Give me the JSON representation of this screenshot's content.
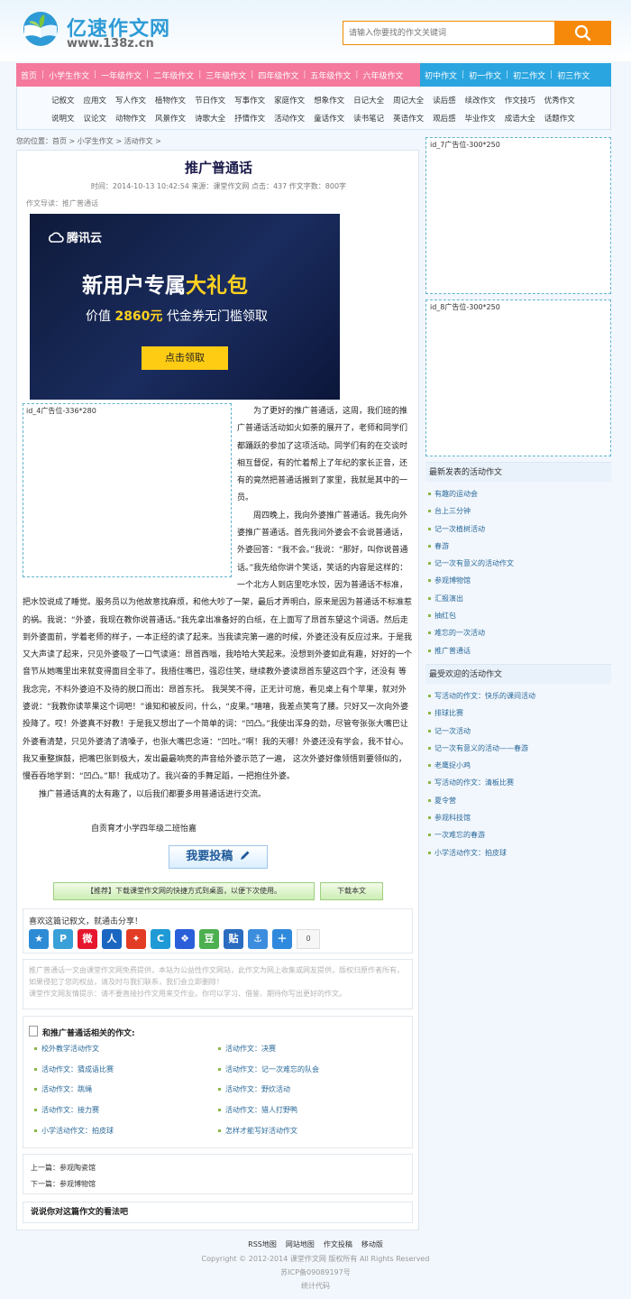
{
  "site": {
    "name": "亿速作文网",
    "url": "www.138z.cn"
  },
  "search": {
    "placeholder": "请输入你要找的作文关键词"
  },
  "nav": {
    "pink": [
      "首页",
      "小学生作文",
      "一年级作文",
      "二年级作文",
      "三年级作文",
      "四年级作文",
      "五年级作文",
      "六年级作文"
    ],
    "blue": [
      "初中作文",
      "初一作文",
      "初二作文",
      "初三作文"
    ]
  },
  "subnav": {
    "row1": [
      "记叙文",
      "应用文",
      "写人作文",
      "植物作文",
      "节日作文",
      "写事作文",
      "家庭作文",
      "想象作文",
      "日记大全",
      "周记大全",
      "读后感",
      "续改作文",
      "作文技巧",
      "优秀作文"
    ],
    "row2": [
      "说明文",
      "议论文",
      "动物作文",
      "风景作文",
      "诗歌大全",
      "抒情作文",
      "活动作文",
      "童话作文",
      "读书笔记",
      "英语作文",
      "观后感",
      "毕业作文",
      "成语大全",
      "话题作文"
    ]
  },
  "breadcrumb": "您的位置：首页 > 小学生作文 > 活动作文 >",
  "article": {
    "title": "推广普通话",
    "meta": "时间：2014-10-13 10:42:54   来源：课堂作文网   点击：437   作文字数：800字",
    "intro": "作文导读：推广普通话",
    "ad_label": "id_4广告位-336*280",
    "paragraphs": [
      "为了更好的推广普通话，这周，我们班的推广普通话活动如火如荼的展开了，老师和同学们都踊跃的参加了这项活动。同学们有的在交谈时相互督促，有的忙着帮上了年纪的家长正音，还有的竟然把普通话搬到了家里，我就是其中的一员。",
      "周四晚上，我向外婆推广普通话。我先向外婆推广普通话。首先我问外婆会不会说普通话，外婆回答：“我不会。”我说：“那好，叫你说普通话。”我先给你讲个笑话，笑话的内容是这样的：一个北方人到店里吃水饺，因为普通话不标准，把水饺说成了睡觉。服务员以为他故意找麻烦，和他大吵了一架，最后才弄明白，原来是因为普通话不标准惹的祸。我说：“外婆，我现在教你说普通话。”我先拿出准备好的白纸，在上面写了昂首东望这个词语。然后走到外婆面前，学着老师的样子，一本正经的读了起来。当我读完第一遍的时候，外婆还没有反应过来。于是我又大声读了起来，只见外婆吸了一口气读道：昂首西嗡，我哈哈大笑起来。没想到外婆如此有趣，好好的一个音节从她嘴里出来就变得面目全非了。我捂住嘴巴，强忍住笑，继续教外婆读昂首东望这四个字，还没有 等我念完，不料外婆迫不及待的脱口而出：昂首东托。 我哭笑不得，正无计可施，看见桌上有个苹果，就对外婆说：“我教你读苹果这个词吧！”谁知和被反问，什么，“皮果。”嘻嘻，我差点笑弯了腰。只好又一次向外婆投降了。哎！外婆真不好教！于是我又想出了一个简单的词：“凹凸。”我使出浑身的劲，尽管夸张张大嘴巴让外婆看清楚，只见外婆清了清嗓子，也张大嘴巴念道：“凹吐。”啊！我的天哪！外婆还没有学会，我不甘心。我又重整旗鼓，把嘴巴张到极大，发出最最响亮的声音给外婆示范了一遍， 这次外婆好像领悟到要领似的，慢吞吞地学到：“凹凸。”耶！我成功了。我兴奋的手舞足蹈，一把抱住外婆。",
      "推广普通话真的太有趣了，以后我们都要多用普通话进行交流。"
    ],
    "signature": "自贡育才小学四年级二班怡嘉",
    "submit_label": "我要投稿",
    "recommend_label": "【推荐】下载课堂作文网的快捷方式到桌面，以便下次使用。",
    "download_label": "下载本文"
  },
  "banner": {
    "brand": "腾讯云",
    "headline_a": "新用户专属",
    "headline_b": "大礼包",
    "sub_a": "价值",
    "sub_b": "2860元",
    "sub_c": "代金券无门槛领取",
    "button": "点击领取"
  },
  "share": {
    "title": "喜欢这篇记叙文，就通击分享！",
    "count": "0"
  },
  "disclaimer": {
    "line1": "推广普通话一文由课堂作文网免费提供，本站为公益性作文网站，此作文为网上收集或网友提供，版权归原作者所有，如果侵犯了您的权益，请及时与我们联系，我们会立即删除！",
    "line2": "课堂作文网友情提示：请不要直接抄作文用来交作业。你可以学习、借鉴、期待你写出更好的作文。"
  },
  "related": {
    "title": "和推广普通话相关的作文:",
    "left": [
      "校外教学活动作文",
      "活动作文：猜成语比赛",
      "活动作文：跳绳",
      "活动作文：接力赛",
      "小学活动作文：拍皮球"
    ],
    "right": [
      "活动作文：决赛",
      "活动作文：记一次难忘的队会",
      "活动作文：野炊活动",
      "活动作文：猎人打野鸭",
      "怎样才能写好活动作文"
    ]
  },
  "prevnext": {
    "prev": "上一篇：参观陶瓷馆",
    "next": "下一篇：参观博物馆"
  },
  "comment": "说说你对这篇作文的看法吧",
  "sidebar": {
    "ad7": "id_7广告位-300*250",
    "ad8": "id_8广告位-300*250",
    "latest_title": "最新发表的活动作文",
    "latest": [
      "有趣的运动会",
      "台上三分钟",
      "记一次植树活动",
      "春游",
      "记一次有意义的活动作文",
      "参观博物馆",
      "汇报演出",
      "抽红包",
      "难忘的一次活动",
      "推广普通话"
    ],
    "popular_title": "最受欢迎的活动作文",
    "popular": [
      "写活动的作文：快乐的课间活动",
      "排球比赛",
      "记一次活动",
      "记一次有意义的活动——春游",
      "老鹰捉小鸡",
      "写活动的作文：清板比赛",
      "夏令营",
      "参观科技馆",
      "一次难忘的春游",
      "小学活动作文：拍皮球"
    ]
  },
  "footer": {
    "links": [
      "RSS地图",
      "网站地图",
      "作文投稿",
      "移动版"
    ],
    "copyright": "Copyright © 2012-2014  课堂作文网  版权所有 All Rights Reserved",
    "icp": "苏ICP备09089197号",
    "stats": "统计代码"
  },
  "colors": {
    "nav_pink": "#f4799c",
    "nav_blue": "#2aa5e0",
    "search_orange": "#f7890a",
    "link": "#2a6a9a"
  }
}
